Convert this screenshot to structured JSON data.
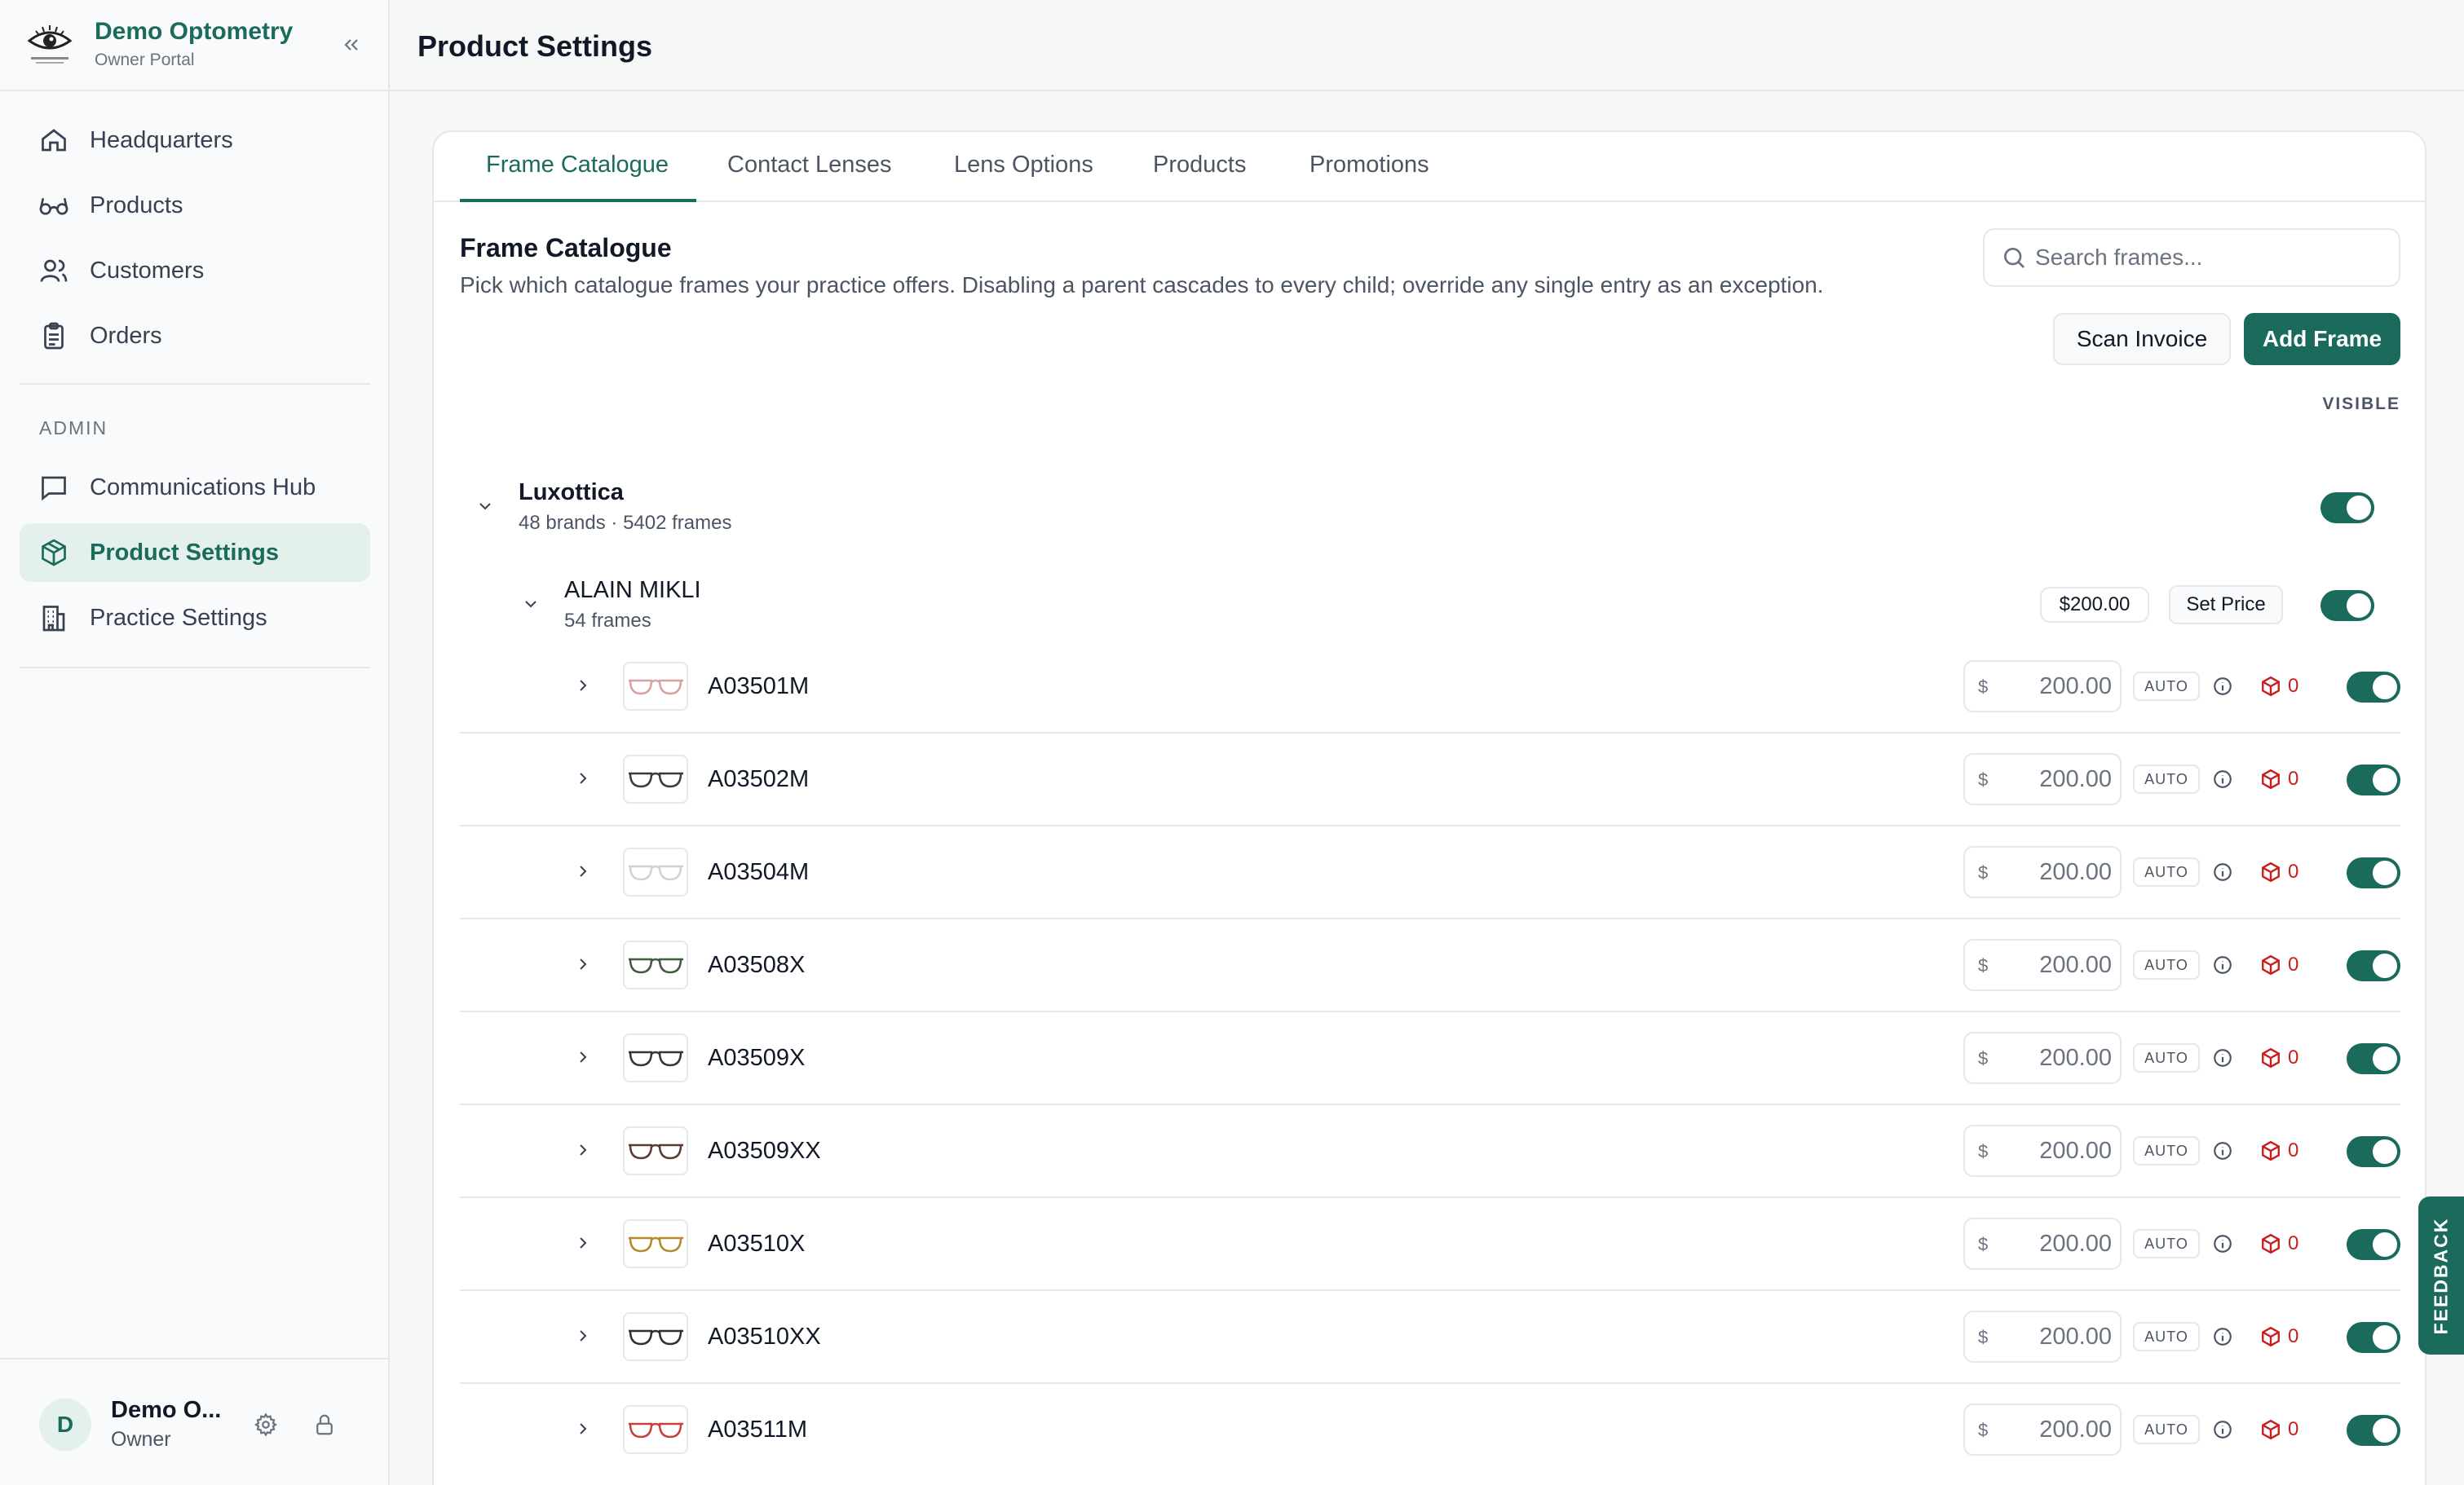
{
  "brand": {
    "name": "Demo Optometry",
    "subtitle": "Owner Portal"
  },
  "nav": {
    "items": [
      {
        "label": "Headquarters",
        "icon": "home-icon"
      },
      {
        "label": "Products",
        "icon": "glasses-icon"
      },
      {
        "label": "Customers",
        "icon": "users-icon"
      },
      {
        "label": "Orders",
        "icon": "clipboard-icon"
      }
    ],
    "admin_label": "ADMIN",
    "admin_items": [
      {
        "label": "Communications Hub",
        "icon": "message-icon"
      },
      {
        "label": "Product Settings",
        "icon": "box-icon",
        "active": true
      },
      {
        "label": "Practice Settings",
        "icon": "building-icon"
      }
    ]
  },
  "user": {
    "initial": "D",
    "name": "Demo O...",
    "role": "Owner"
  },
  "header": {
    "title": "Product Settings"
  },
  "tabs": [
    "Frame Catalogue",
    "Contact Lenses",
    "Lens Options",
    "Products",
    "Promotions"
  ],
  "catalogue": {
    "title": "Frame Catalogue",
    "description": "Pick which catalogue frames your practice offers. Disabling a parent cascades to every child; override any single entry as an exception.",
    "search_placeholder": "Search frames...",
    "scan_invoice": "Scan Invoice",
    "add_frame": "Add Frame",
    "visible_header": "VISIBLE"
  },
  "group": {
    "name": "Luxottica",
    "meta": "48 brands · 5402 frames",
    "visible": true
  },
  "brand_row": {
    "name": "ALAIN MIKLI",
    "meta": "54 frames",
    "price": "$200.00",
    "set_price": "Set Price",
    "visible": true
  },
  "frames": [
    {
      "code": "A03501M",
      "currency": "$",
      "price": "200.00",
      "auto": "AUTO",
      "stock": "0",
      "frame_color": "#d9a0a0"
    },
    {
      "code": "A03502M",
      "currency": "$",
      "price": "200.00",
      "auto": "AUTO",
      "stock": "0",
      "frame_color": "#3a3a3a"
    },
    {
      "code": "A03504M",
      "currency": "$",
      "price": "200.00",
      "auto": "AUTO",
      "stock": "0",
      "frame_color": "#cfd3d6"
    },
    {
      "code": "A03508X",
      "currency": "$",
      "price": "200.00",
      "auto": "AUTO",
      "stock": "0",
      "frame_color": "#3f5a3c"
    },
    {
      "code": "A03509X",
      "currency": "$",
      "price": "200.00",
      "auto": "AUTO",
      "stock": "0",
      "frame_color": "#3a3330"
    },
    {
      "code": "A03509XX",
      "currency": "$",
      "price": "200.00",
      "auto": "AUTO",
      "stock": "0",
      "frame_color": "#5a3a32"
    },
    {
      "code": "A03510X",
      "currency": "$",
      "price": "200.00",
      "auto": "AUTO",
      "stock": "0",
      "frame_color": "#b48a2a"
    },
    {
      "code": "A03510XX",
      "currency": "$",
      "price": "200.00",
      "auto": "AUTO",
      "stock": "0",
      "frame_color": "#2f2f2f"
    },
    {
      "code": "A03511M",
      "currency": "$",
      "price": "200.00",
      "auto": "AUTO",
      "stock": "0",
      "frame_color": "#c9403a"
    }
  ],
  "feedback": "FEEDBACK",
  "colors": {
    "accent": "#1a6b5c",
    "accent_soft": "#e3f0ec",
    "stock_red": "#c81e1e"
  }
}
